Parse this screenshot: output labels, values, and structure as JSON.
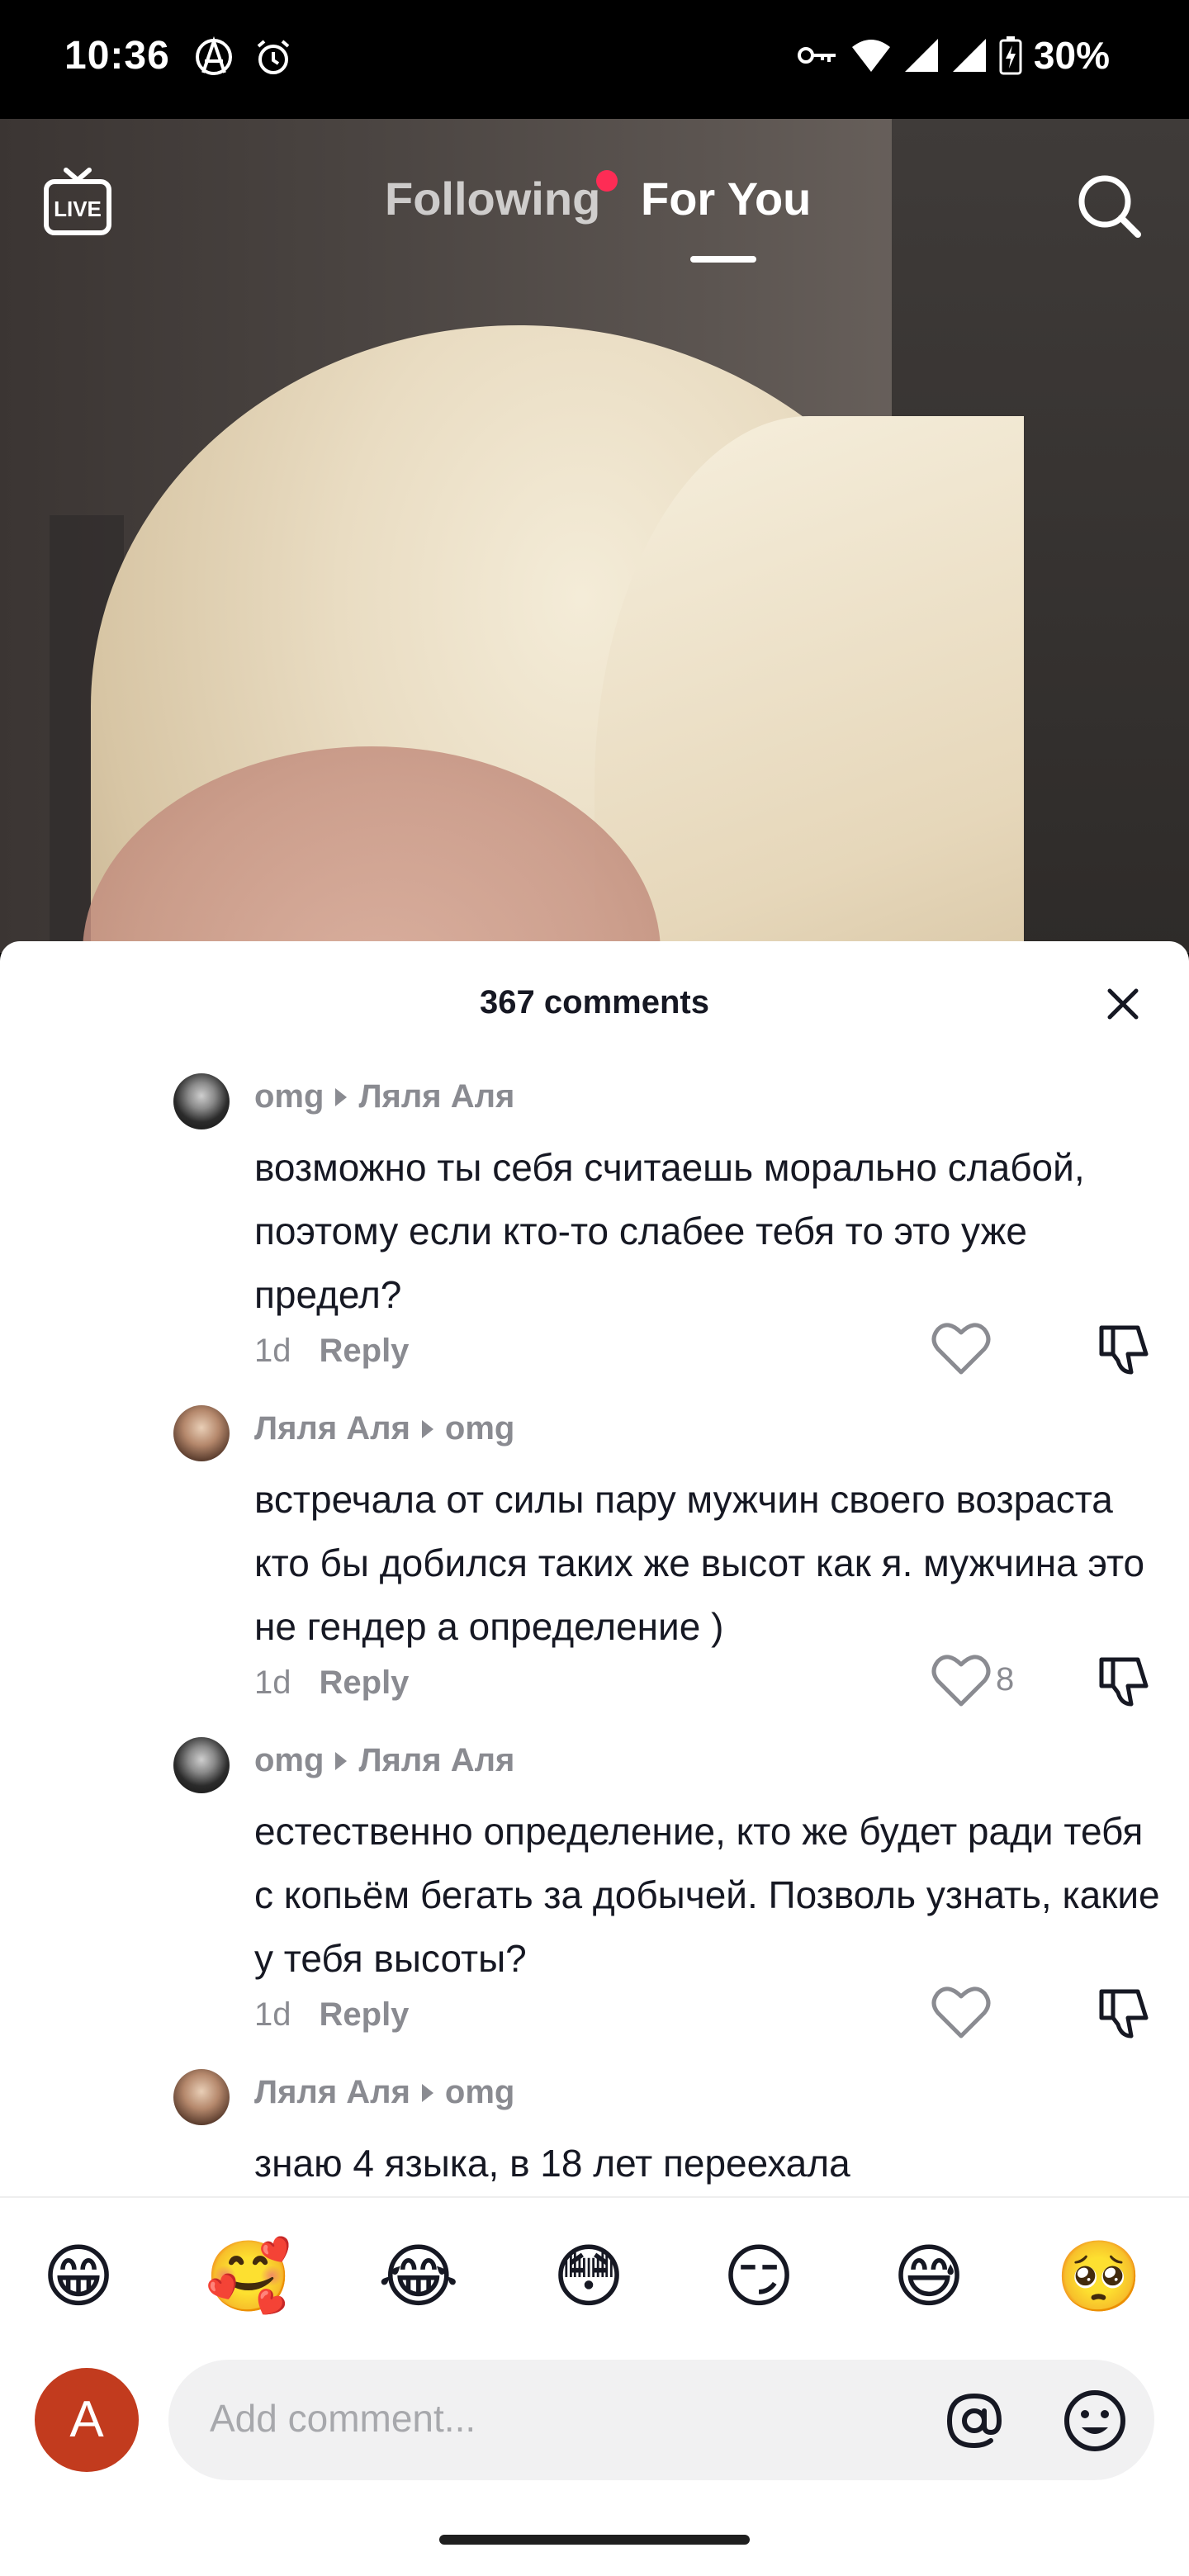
{
  "status_bar": {
    "time": "10:36",
    "battery": "30%"
  },
  "top_nav": {
    "tabs": [
      {
        "label": "Following"
      },
      {
        "label": "For You"
      }
    ],
    "live_label": "LIVE"
  },
  "comments_sheet": {
    "title": "367 comments",
    "comments": [
      {
        "author": "omg",
        "reply_to": "Ляля Аля",
        "text": "возможно ты себя считаешь морально слабой, поэтому если кто-то слабее тебя то это уже предел?",
        "age": "1d",
        "reply_label": "Reply",
        "likes": ""
      },
      {
        "author": "Ляля Аля",
        "reply_to": "omg",
        "text": "встречала от силы пару мужчин своего возраста кто бы добился таких же высот как я. мужчина это не гендер а определение )",
        "age": "1d",
        "reply_label": "Reply",
        "likes": "8"
      },
      {
        "author": "omg",
        "reply_to": "Ляля Аля",
        "text": "естественно определение, кто же будет ради тебя с копьём бегать за добычей. Позволь узнать, какие у тебя высоты?",
        "age": "1d",
        "reply_label": "Reply",
        "likes": ""
      },
      {
        "author": "Ляля Аля",
        "reply_to": "omg",
        "text": "знаю 4 языка, в 18 лет переехала",
        "age": "",
        "reply_label": "",
        "likes": ""
      }
    ]
  },
  "emoji_bar": [
    "😁",
    "🥰",
    "😂",
    "😳",
    "😏",
    "😅",
    "🥺"
  ],
  "comment_input": {
    "avatar_letter": "A",
    "placeholder": "Add comment..."
  }
}
